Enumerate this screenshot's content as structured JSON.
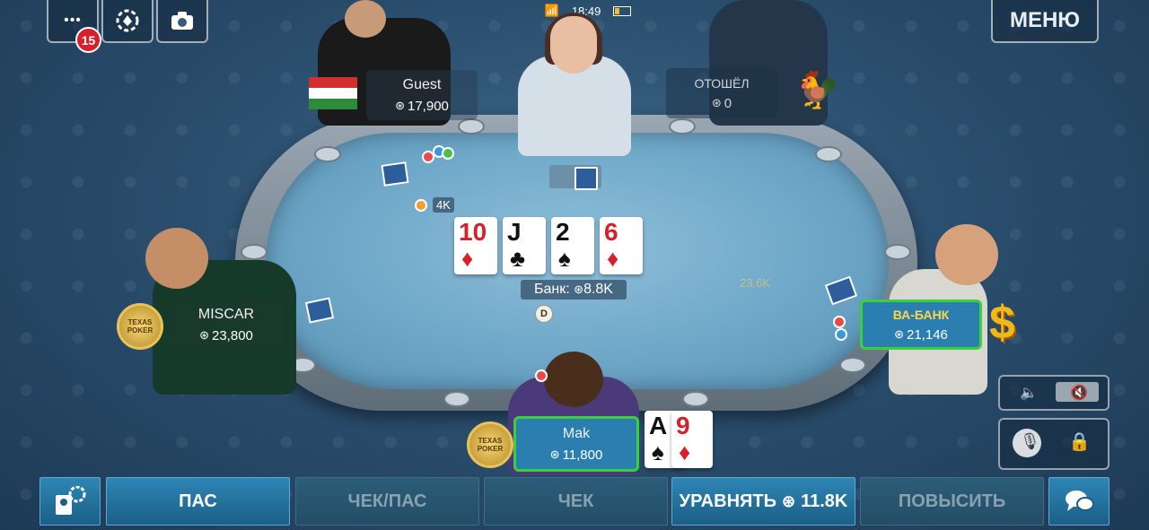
{
  "status_bar": {
    "time": "18:49"
  },
  "top_bar": {
    "more_icon": "•••",
    "notification_count": "15",
    "menu_label": "МЕНЮ"
  },
  "players": {
    "guest": {
      "name": "Guest",
      "stack": "17,900",
      "flag": "Hungary"
    },
    "away": {
      "name": "ОТОШЁЛ",
      "stack": "0"
    },
    "miscar": {
      "name": "MISCAR",
      "stack": "23,800"
    },
    "allin": {
      "name": "ВА-БАНК",
      "stack": "21,146"
    },
    "hero": {
      "name": "Mak",
      "stack": "11,800"
    }
  },
  "community_cards": [
    {
      "rank": "10",
      "suit": "♦",
      "color": "red"
    },
    {
      "rank": "J",
      "suit": "♣",
      "color": "black"
    },
    {
      "rank": "2",
      "suit": "♠",
      "color": "black"
    },
    {
      "rank": "6",
      "suit": "♦",
      "color": "red"
    }
  ],
  "hero_cards": [
    {
      "rank": "A",
      "suit": "♠",
      "color": "black"
    },
    {
      "rank": "9",
      "suit": "♦",
      "color": "red"
    }
  ],
  "pot": {
    "label": "Банк:",
    "amount": "8.8K"
  },
  "bets": {
    "guest_bet": "4K",
    "allin_bet": "23.6K"
  },
  "dealer_button": "D",
  "texas_badge": "TEXAS POKER",
  "actions": {
    "fold": "ПАС",
    "check_fold": "ЧЕК/ПАС",
    "check": "ЧЕК",
    "call": "УРАВНЯТЬ",
    "call_amount": "11.8K",
    "raise": "ПОВЫСИТЬ"
  },
  "chip_symbol": "⊛",
  "colors": {
    "felt": "#6ea7c8",
    "action_button": "#2e86b4",
    "highlight_green": "#3ccf3c",
    "badge_red": "#d8202a",
    "dollar_gold": "#f2b81a"
  }
}
